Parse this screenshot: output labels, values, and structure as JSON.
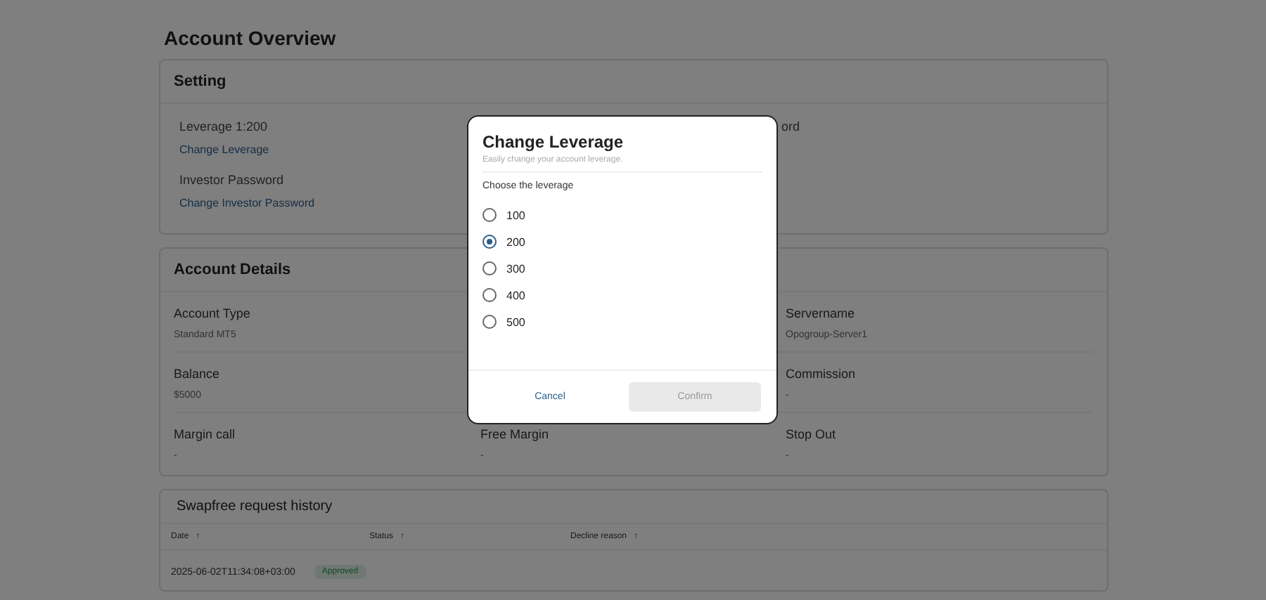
{
  "page_title": "Account Overview",
  "setting": {
    "title": "Setting",
    "leverage": "Leverage 1:200",
    "change_leverage": "Change Leverage",
    "investor_password": "Investor Password",
    "change_investor_password": "Change Investor Password",
    "right_fragment": "ord"
  },
  "account_details": {
    "title": "Account Details",
    "rows": [
      [
        {
          "label": "Account Type",
          "value": "Standard MT5"
        },
        null,
        {
          "label": "Servername",
          "value": "Opogroup-Server1"
        }
      ],
      [
        {
          "label": "Balance",
          "value": "$5000"
        },
        null,
        {
          "label": "Commission",
          "value": "-"
        }
      ],
      [
        {
          "label": "Margin call",
          "value": "-"
        },
        {
          "label": "Free Margin",
          "value": "-"
        },
        {
          "label": "Stop Out",
          "value": "-"
        }
      ]
    ]
  },
  "swapfree": {
    "title": "Swapfree request history",
    "columns": [
      "Date",
      "Status",
      "Decline reason"
    ],
    "sort_icon": "↑",
    "rows": [
      {
        "date": "2025-06-02T11:34:08+03:00",
        "status": "Approved"
      }
    ]
  },
  "modal": {
    "title": "Change Leverage",
    "subtitle": "Easily change your account leverage.",
    "prompt": "Choose the leverage",
    "options": [
      {
        "label": "100",
        "selected": false
      },
      {
        "label": "200",
        "selected": true
      },
      {
        "label": "300",
        "selected": false
      },
      {
        "label": "400",
        "selected": false
      },
      {
        "label": "500",
        "selected": false
      }
    ],
    "cancel": "Cancel",
    "confirm": {
      "label": "Confirm",
      "disabled": true
    }
  }
}
